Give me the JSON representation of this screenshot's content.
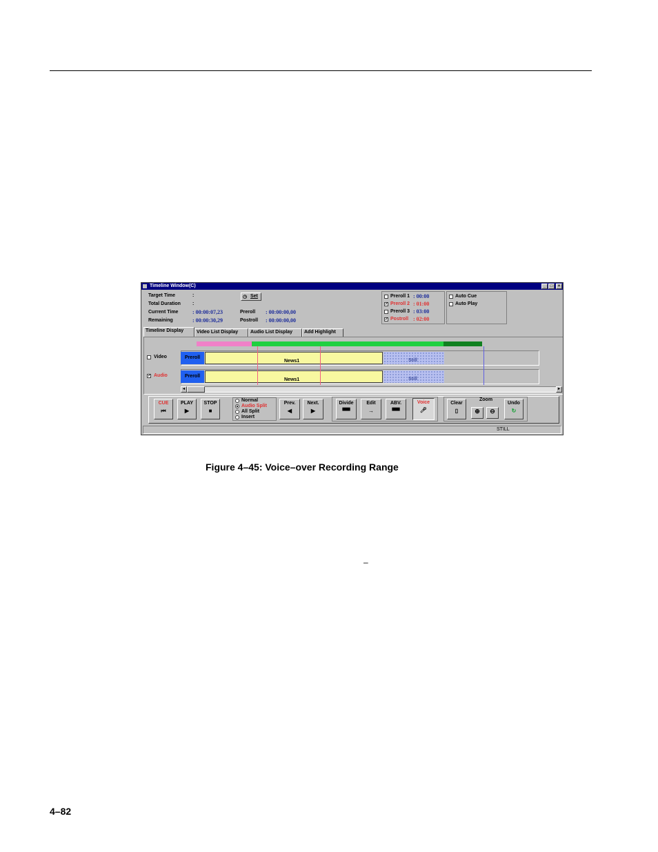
{
  "figure": {
    "caption": "Figure 4–45: Voice–over Recording Range"
  },
  "page": {
    "number": "4–82",
    "stray_mark": "–"
  },
  "window": {
    "title": "Timeline Window(C)",
    "buttons": {
      "minimize": "_",
      "maximize": "□",
      "close": "×"
    },
    "info": {
      "target_time_label": "Target Time",
      "target_time_sep": ":",
      "total_duration_label": "Total Duration",
      "total_duration_sep": ":",
      "current_time_label": "Current Time",
      "current_time_value": ": 00:00:07,23",
      "remaining_label": "Remaining",
      "remaining_value": ": 00:00:30,29",
      "set_button": "Set",
      "preroll_label": "Preroll",
      "preroll_value": ": 00:00:00,00",
      "postroll_label": "Postroll",
      "postroll_value": ": 00:00:00,00"
    },
    "preroll_options": [
      {
        "label": "Preroll 1",
        "value": ": 00:00",
        "checked": false,
        "highlight": false
      },
      {
        "label": "Preroll 2",
        "value": ": 01:00",
        "checked": true,
        "highlight": true
      },
      {
        "label": "Preroll 3",
        "value": ": 03:00",
        "checked": false,
        "highlight": false
      },
      {
        "label": "Postroll",
        "value": ": 02:00",
        "checked": true,
        "highlight": true
      }
    ],
    "auto_options": [
      {
        "label": "Auto Cue",
        "checked": false
      },
      {
        "label": "Auto Play",
        "checked": false
      }
    ],
    "tabs": [
      "Timeline Display",
      "Video List Display",
      "Audio List Display",
      "Add Highlight"
    ],
    "active_tab": 0,
    "tracks": {
      "video": {
        "label": "Video",
        "checked": false,
        "preroll": "Preroll",
        "clip": "News1",
        "still": "Still"
      },
      "audio": {
        "label": "Audio",
        "checked": true,
        "preroll": "Preroll",
        "clip": "News1",
        "still": "Still"
      }
    },
    "controls": {
      "cue": {
        "label": "CUE",
        "glyph": "⏮"
      },
      "play": {
        "label": "PLAY",
        "glyph": "▶"
      },
      "stop": {
        "label": "STOP",
        "glyph": "■"
      },
      "modes": [
        "Normal",
        "Audio Split",
        "All Split",
        "Insert"
      ],
      "selected_mode": 1,
      "prev": {
        "label": "Prev.",
        "glyph": "◀"
      },
      "next": {
        "label": "Next.",
        "glyph": "▶"
      },
      "divide": {
        "label": "Divide"
      },
      "edit": {
        "label": "Edit"
      },
      "abv": {
        "label": "ABV."
      },
      "voice": {
        "label": "Voice"
      },
      "clear": {
        "label": "Clear"
      },
      "zoom": {
        "label": "Zoom",
        "in": "⊕",
        "out": "⊖"
      },
      "undo": {
        "label": "Undo",
        "glyph": "↻"
      }
    },
    "status": "STILL"
  }
}
